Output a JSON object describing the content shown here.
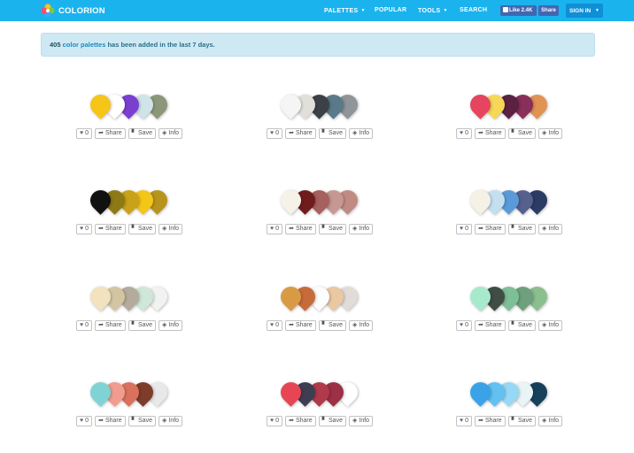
{
  "navbar": {
    "brand": "COLORION",
    "items": [
      {
        "label": "PALETTES",
        "caret": "▼"
      },
      {
        "label": "POPULAR"
      },
      {
        "label": "TOOLS",
        "caret": "▼"
      },
      {
        "label": "SEARCH"
      }
    ],
    "fb_like_label": "Like 2.4K",
    "fb_share_label": "Share",
    "signin_label": "SIGN IN",
    "signin_caret": "▼",
    "bar_color": "#1ab3ee"
  },
  "alert": {
    "count": "405",
    "link_text": "color palettes",
    "rest_text": "has been added in the last 7 days."
  },
  "card_actions": {
    "likes": "0",
    "share": "Share",
    "save": "Save",
    "info": "Info"
  },
  "palettes": [
    {
      "colors": [
        "#f5c518",
        "#ffffff",
        "#7a3fd1",
        "#cfe3e8",
        "#8c977a"
      ]
    },
    {
      "colors": [
        "#f5f5f5",
        "#e0dfda",
        "#3c4147",
        "#5a7a8a",
        "#8f9598"
      ]
    },
    {
      "colors": [
        "#e6445f",
        "#f6d756",
        "#5a2142",
        "#8a2f59",
        "#e09352"
      ]
    },
    {
      "colors": [
        "#111111",
        "#8d7a14",
        "#c9a21a",
        "#f3c618",
        "#b8941c"
      ]
    },
    {
      "colors": [
        "#f6f2ea",
        "#6e1c1c",
        "#a6605e",
        "#c69793",
        "#c08b83"
      ]
    },
    {
      "colors": [
        "#f6f1e6",
        "#c4dff0",
        "#5b9ad8",
        "#56608f",
        "#2b3c64"
      ]
    },
    {
      "colors": [
        "#f2e2bd",
        "#d3c5a1",
        "#b5ab9c",
        "#cfe7d9",
        "#f1f3f1"
      ]
    },
    {
      "colors": [
        "#d99a45",
        "#c86b3a",
        "#fdfdfd",
        "#e9c8a2",
        "#e2dcd8"
      ]
    },
    {
      "colors": [
        "#a7eacb",
        "#3f4d45",
        "#7dbf96",
        "#6fa07e",
        "#8bbf8d"
      ]
    },
    {
      "colors": [
        "#7fd3d4",
        "#f29b8f",
        "#d9715c",
        "#7e3c2a",
        "#e8e8e8"
      ]
    },
    {
      "colors": [
        "#e64653",
        "#3e3d52",
        "#b03a4a",
        "#9c3044",
        "#ffffff"
      ]
    },
    {
      "colors": [
        "#3aa3e8",
        "#62c1f0",
        "#97d8f6",
        "#e8f4f6",
        "#17405a"
      ]
    }
  ]
}
